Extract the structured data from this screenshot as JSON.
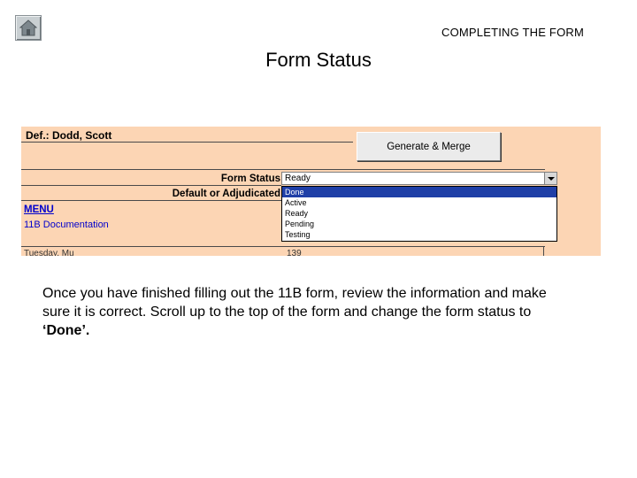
{
  "header": {
    "section_label": "COMPLETING THE FORM",
    "title": "Form Status",
    "home_icon": "home-icon"
  },
  "sheet": {
    "defendant": "Def.: Dodd, Scott",
    "generate_button": "Generate & Merge",
    "form_status_label": "Form Status",
    "default_label": "Default or Adjudicated",
    "form_status_value": "Ready",
    "options": [
      "Done",
      "Active",
      "Ready",
      "Pending",
      "Testing"
    ],
    "highlighted_option": "Done",
    "menu_link": "MENU",
    "doc_link": "11B Documentation",
    "partial_left": "Tuesday, Mu",
    "partial_mid": "139"
  },
  "instructions": {
    "before": "Once you have finished filling out the 11B form, review the information and make sure it is correct. Scroll up to the top of the form and change the form status to ",
    "emphasis": "‘Done’."
  },
  "colors": {
    "sheet_background": "#fcd5b4",
    "selection": "#1f3fa7",
    "link": "#0000cc"
  }
}
